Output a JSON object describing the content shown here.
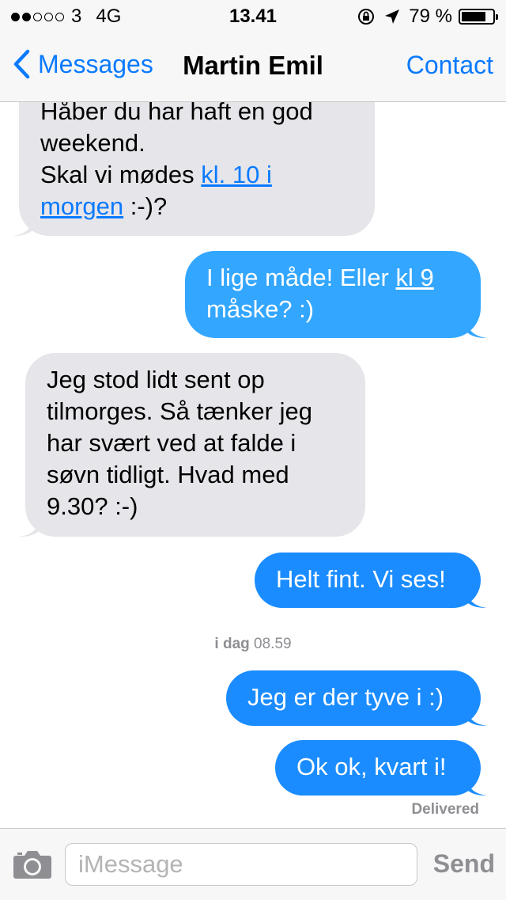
{
  "status_bar": {
    "signal_filled": 2,
    "signal_total": 5,
    "carrier": "3",
    "network": "4G",
    "time": "13.41",
    "battery_percent": "79 %",
    "battery_level": 0.79
  },
  "nav": {
    "back_label": "Messages",
    "title": "Martin Emil",
    "contact_label": "Contact"
  },
  "messages": [
    {
      "direction": "incoming",
      "lines": [
        "Håber du har haft en god",
        "weekend.",
        "Skal vi mødes ",
        "kl. 10 i",
        "morgen",
        " :-)?"
      ]
    },
    {
      "direction": "outgoing",
      "parts": [
        "I lige måde! Eller ",
        "kl 9",
        "måske? :)"
      ]
    },
    {
      "direction": "incoming",
      "lines": [
        "Jeg stod lidt sent op",
        "tilmorges. Så tænker jeg",
        "har svært ved at falde i",
        "søvn tidligt. Hvad med",
        "9.30? :-)"
      ]
    },
    {
      "direction": "outgoing",
      "text": "Helt fint. Vi ses!"
    },
    {
      "direction": "outgoing",
      "text": "Jeg er der tyve i :)"
    },
    {
      "direction": "outgoing",
      "text": "Ok ok, kvart i!"
    }
  ],
  "timestamp": {
    "day": "i dag",
    "time": "08.59"
  },
  "delivered_label": "Delivered",
  "input": {
    "placeholder": "iMessage",
    "send_label": "Send"
  },
  "colors": {
    "ios_blue": "#0a7aff",
    "outgoing_bubble": "#1a8cff",
    "incoming_bubble": "#e5e5ea",
    "meta_gray": "#8e8e93"
  }
}
